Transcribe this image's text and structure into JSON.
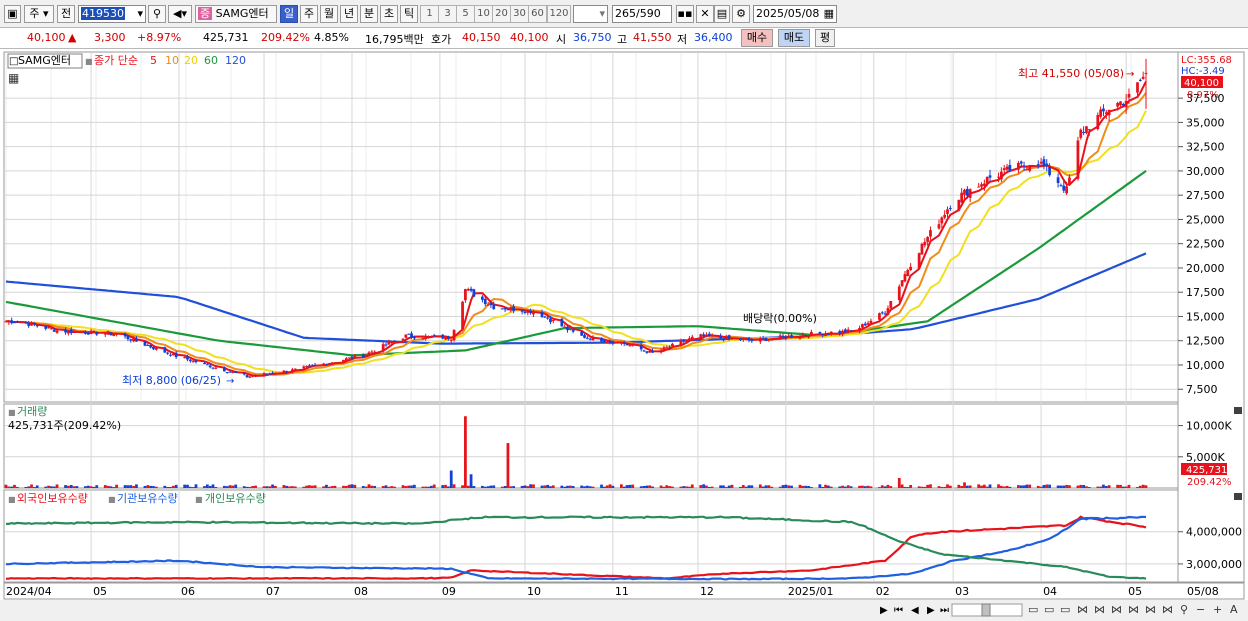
{
  "toolbar": {
    "market_label": "주",
    "prev_label": "전",
    "code": "419530",
    "category_icon": "증",
    "stock_name": "SAMG엔터",
    "periods": [
      "일",
      "주",
      "월",
      "년",
      "분",
      "초",
      "틱"
    ],
    "active_period": "일",
    "intervals": [
      "1",
      "3",
      "5",
      "10",
      "20",
      "30",
      "60",
      "120"
    ],
    "count": "265",
    "count_total": "/590",
    "date": "2025/05/08"
  },
  "quote": {
    "price": "40,100",
    "change_arrow": "▲",
    "change": "3,300",
    "change_pct": "+8.97%",
    "volume": "425,731",
    "volume_ratio": "209.42%",
    "turnover": "4.85%",
    "amount": "16,795백만",
    "bid_label": "호가",
    "bid1": "40,150",
    "bid2": "40,100",
    "open_label": "시",
    "open": "36,750",
    "high_label": "고",
    "high": "41,550",
    "low_label": "저",
    "low": "36,400",
    "buy_label": "매수",
    "sell_label": "매도",
    "eval_label": "평"
  },
  "colors": {
    "up": "#e8121c",
    "down": "#1540d8",
    "ma5": "#e8121c",
    "ma10": "#f08c18",
    "ma20": "#f0e020",
    "ma60": "#1a9a3a",
    "ma120": "#2050d8",
    "foreign": "#e8121c",
    "institution": "#2060e0",
    "individual": "#2a8a5a",
    "grid": "#d6d6d6"
  },
  "chart_data": [
    {
      "type": "candlestick",
      "panel": "price",
      "legend": {
        "name": "SAMG엔터",
        "ma_prefix": "종가 단순",
        "ma_periods": [
          "5",
          "10",
          "20",
          "60",
          "120"
        ]
      },
      "right_labels": {
        "lc": "LC:355.68",
        "hc": "HC:-3.49",
        "last": "40,100",
        "last_pct": "8.97%"
      },
      "y_ticks": [
        "7,500",
        "10,000",
        "12,500",
        "15,000",
        "17,500",
        "20,000",
        "22,500",
        "25,000",
        "27,500",
        "30,000",
        "32,500",
        "35,000",
        "37,500"
      ],
      "y_tick_values": [
        7500,
        10000,
        12500,
        15000,
        17500,
        20000,
        22500,
        25000,
        27500,
        30000,
        32500,
        35000,
        37500
      ],
      "ylim": [
        6700,
        40400
      ],
      "x_labels": [
        "2024/04",
        "05",
        "06",
        "07",
        "08",
        "09",
        "10",
        "11",
        "12",
        "2025/01",
        "02",
        "03",
        "04",
        "05",
        "05/08"
      ],
      "anchor_dates": [
        "2024-04-05",
        "2024-04-20",
        "2024-05-10",
        "2024-05-30",
        "2024-06-25",
        "2024-07-12",
        "2024-08-05",
        "2024-08-20",
        "2024-09-05",
        "2024-09-10",
        "2024-09-20",
        "2024-10-05",
        "2024-10-20",
        "2024-11-05",
        "2024-11-15",
        "2024-12-01",
        "2024-12-20",
        "2025-01-10",
        "2025-01-25",
        "2025-02-05",
        "2025-02-15",
        "2025-03-01",
        "2025-03-15",
        "2025-03-31",
        "2025-04-10",
        "2025-04-15",
        "2025-04-25",
        "2025-05-02",
        "2025-05-08"
      ],
      "anchor_close": [
        14500,
        13500,
        13200,
        11000,
        8800,
        9500,
        11000,
        13000,
        12800,
        17800,
        16000,
        15500,
        13000,
        12200,
        11200,
        13000,
        12500,
        13200,
        13500,
        15500,
        21000,
        27000,
        29500,
        31000,
        28000,
        34000,
        36500,
        37500,
        40100
      ],
      "annotations": [
        {
          "label": "최고 41,550 (05/08)",
          "date": "2025-05-08",
          "value": 41550
        },
        {
          "label": "최저 8,800 (06/25)",
          "date": "2024-06-25",
          "value": 8800
        },
        {
          "label": "배당락(0.00%)",
          "date": "2025-01-02",
          "value": 13300
        }
      ],
      "moving_averages": {
        "ma60": {
          "dates": [
            "2024-04-01",
            "2024-06-15",
            "2024-08-01",
            "2024-09-10",
            "2024-10-15",
            "2024-12-01",
            "2025-01-15",
            "2025-02-20",
            "2025-03-31",
            "2025-05-08"
          ],
          "values": [
            16500,
            12500,
            11000,
            11500,
            13800,
            14000,
            13000,
            14500,
            22000,
            30000
          ]
        },
        "ma120": {
          "dates": [
            "2024-04-01",
            "2024-06-01",
            "2024-07-15",
            "2024-09-01",
            "2024-11-01",
            "2025-01-15",
            "2025-02-15",
            "2025-03-31",
            "2025-05-08"
          ],
          "values": [
            18600,
            17000,
            12800,
            12200,
            12300,
            13000,
            13700,
            16800,
            21500
          ]
        }
      }
    },
    {
      "type": "bar",
      "panel": "volume",
      "title": "거래량",
      "value_label": "425,731주(209.42%)",
      "y_ticks": [
        "5,000K",
        "10,000K"
      ],
      "y_tick_values": [
        5000,
        10000
      ],
      "ylim": [
        0,
        12500
      ],
      "right_labels": {
        "last": "425,731",
        "last_pct": "209.42%"
      },
      "spikes": [
        {
          "date": "2024-09-05",
          "value": 2800
        },
        {
          "date": "2024-09-10",
          "value": 11500
        },
        {
          "date": "2024-09-12",
          "value": 2200
        },
        {
          "date": "2024-09-25",
          "value": 7200
        },
        {
          "date": "2024-10-20",
          "value": 4100
        },
        {
          "date": "2025-02-10",
          "value": 1600
        },
        {
          "date": "2025-03-05",
          "value": 900
        }
      ]
    },
    {
      "type": "line",
      "panel": "holdings",
      "series_names": [
        "외국인보유수량",
        "기관보유수량",
        "개인보유수량"
      ],
      "y_ticks": [
        "3,000,000",
        "4,000,000"
      ],
      "y_tick_values": [
        3000000,
        4000000
      ],
      "ylim": [
        2500000,
        4800000
      ],
      "series": [
        {
          "name": "외국인보유수량",
          "dates": [
            "2024-04-01",
            "2024-08-25",
            "2024-09-05",
            "2024-09-12",
            "2024-11-20",
            "2024-12-10",
            "2025-01-10",
            "2025-02-05",
            "2025-02-15",
            "2025-02-25",
            "2025-03-20",
            "2025-04-10",
            "2025-04-15",
            "2025-05-08"
          ],
          "values": [
            2550000,
            2550000,
            2570000,
            2800000,
            2550000,
            2700000,
            2800000,
            3100000,
            3900000,
            4000000,
            4100000,
            4200000,
            4450000,
            4150000
          ]
        },
        {
          "name": "기관보유수량",
          "dates": [
            "2024-04-01",
            "2024-06-01",
            "2024-07-01",
            "2024-09-05",
            "2024-09-18",
            "2024-12-20",
            "2025-01-25",
            "2025-02-15",
            "2025-03-01",
            "2025-03-20",
            "2025-04-05",
            "2025-04-15",
            "2025-05-08"
          ],
          "values": [
            3000000,
            3100000,
            2900000,
            2850000,
            2550000,
            2530000,
            2550000,
            2700000,
            3100000,
            3400000,
            3800000,
            4400000,
            4450000
          ]
        },
        {
          "name": "개인보유수량",
          "dates": [
            "2024-04-01",
            "2024-06-01",
            "2024-08-25",
            "2024-09-15",
            "2024-12-10",
            "2025-01-25",
            "2025-02-10",
            "2025-02-25",
            "2025-03-20",
            "2025-04-10",
            "2025-04-25",
            "2025-05-08"
          ],
          "values": [
            4250000,
            4300000,
            4250000,
            4450000,
            4450000,
            4300000,
            3700000,
            3300000,
            3100000,
            2900000,
            2600000,
            2550000
          ]
        }
      ]
    }
  ]
}
